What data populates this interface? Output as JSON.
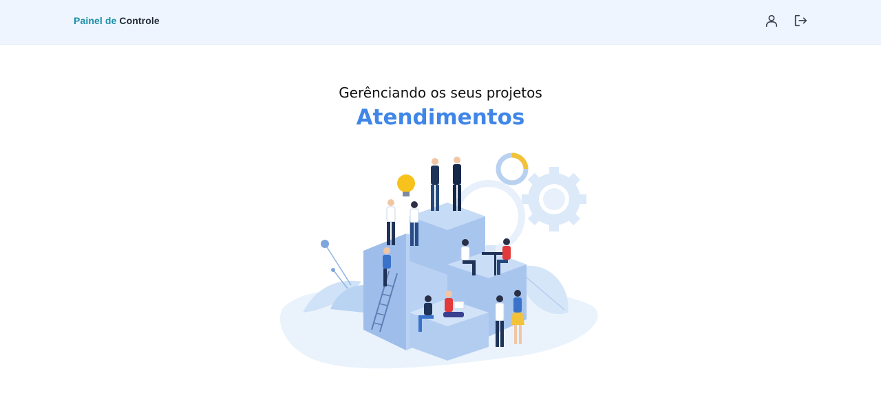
{
  "header": {
    "brand_part1": "Painel de",
    "brand_part2": "Controle",
    "user_icon": "user-icon",
    "logout_icon": "logout-icon"
  },
  "hero": {
    "subtitle": "Gerênciando os seus projetos",
    "title": "Atendimentos"
  },
  "colors": {
    "header_bg": "#eef5fe",
    "brand_teal": "#1a8fa8",
    "title_blue": "#3f86e8"
  }
}
